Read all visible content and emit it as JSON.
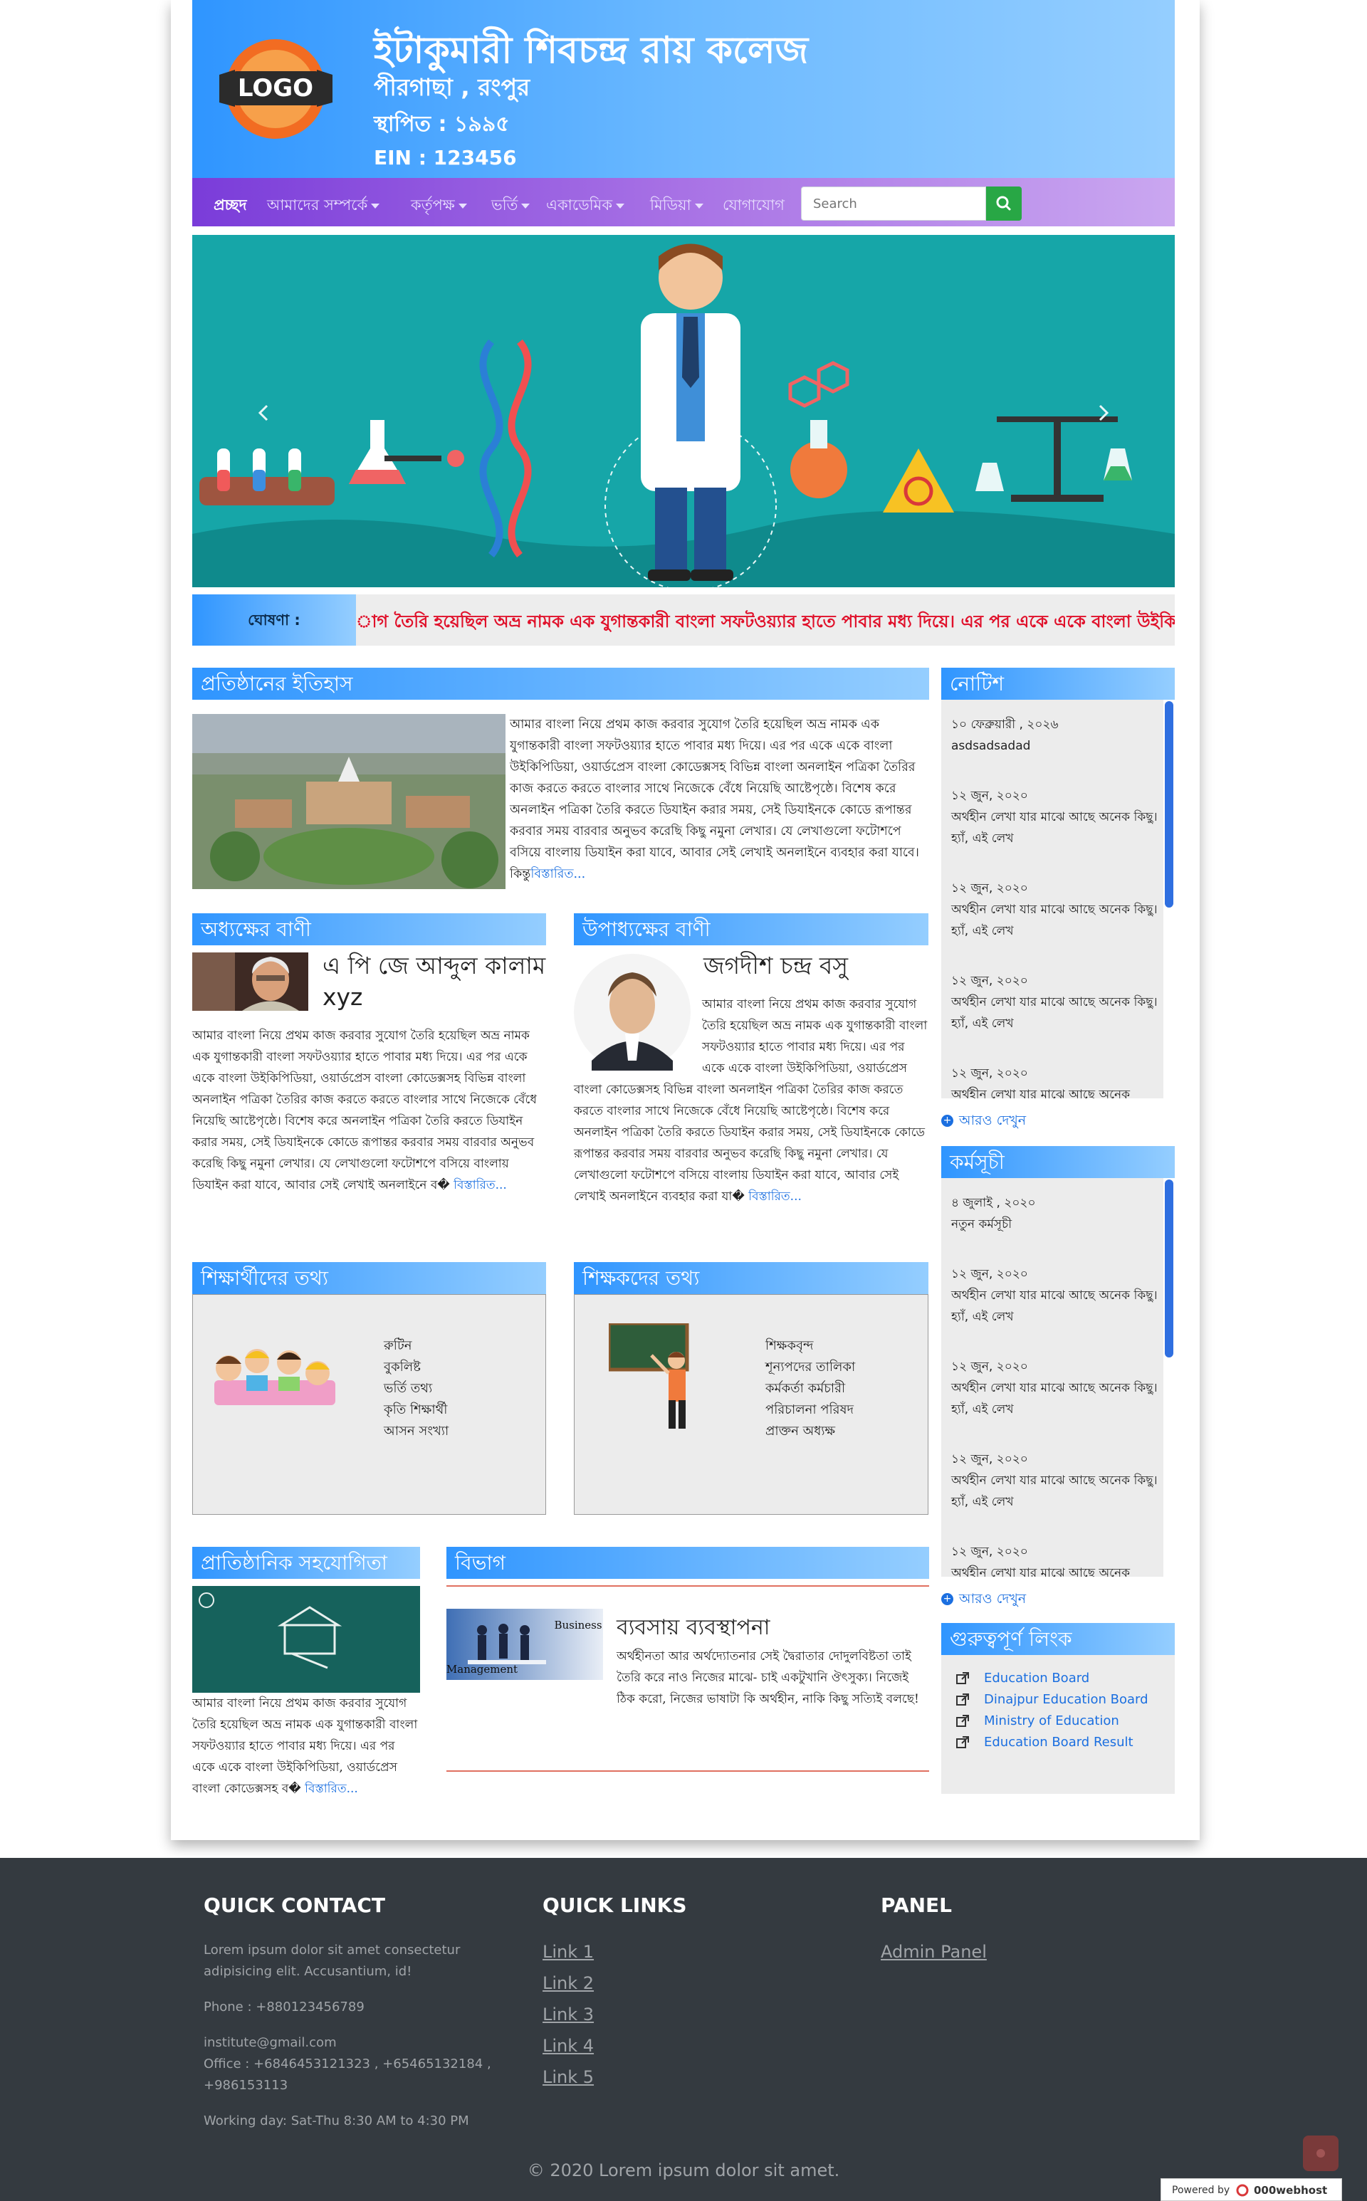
{
  "header": {
    "title": "ইটাকুমারী শিবচন্দ্র রায় কলেজ",
    "subtitle": "পীরগাছা , রংপুর",
    "established": "স্থাপিত : ১৯৯৫",
    "ein": "EIN : 123456",
    "logo_text": "LOGO"
  },
  "nav": {
    "items": [
      "প্রচ্ছদ",
      "আমাদের সম্পর্কে",
      "কর্তৃপক্ষ",
      "ভর্তি",
      "একাডেমিক",
      "মিডিয়া",
      "যোগাযোগ"
    ],
    "search_placeholder": "Search"
  },
  "ticker": {
    "label": "ঘোষণা :",
    "text": "াগ তৈরি হয়েছিল অভ্র নামক এক যুগান্তকারী বাংলা সফটওয়্যার হাতে পাবার মধ্য দিয়ে। এর পর একে একে বাংলা উইকিপিডিয়া, ওয়ার্ড"
  },
  "history": {
    "heading": "প্রতিষ্ঠানের ইতিহাস",
    "text": "আমার বাংলা নিয়ে প্রথম কাজ করবার সুযোগ তৈরি হয়েছিল অভ্র নামক এক যুগান্তকারী বাংলা সফটওয়্যার হাতে পাবার মধ্য দিয়ে। এর পর একে একে বাংলা উইকিপিডিয়া, ওয়ার্ডপ্রেস বাংলা কোডেক্সসহ বিভিন্ন বাংলা অনলাইন পত্রিকা তৈরির কাজ করতে করতে বাংলার সাথে নিজেকে বেঁধে নিয়েছি আষ্টেপৃষ্ঠে। বিশেষ করে অনলাইন পত্রিকা তৈরি করতে ডিযাইন করার সময়, সেই ডিযাইনকে কোডে রূপান্তর করবার সময় বারবার অনুভব করেছি কিছু নমুনা লেখার। যে লেখাগুলো ফটোশপে বসিয়ে বাংলায় ডিযাইন করা যাবে, আবার সেই লেখাই অনলাইনে ব্যবহার করা যাবে। কিন্তু",
    "more": "বিস্তারিত..."
  },
  "principal": {
    "heading": "অধ্যক্ষের বাণী",
    "name": "এ পি জে আব্দুল কালাম xyz",
    "text": "আমার বাংলা নিয়ে প্রথম কাজ করবার সুযোগ তৈরি হয়েছিল অভ্র নামক এক যুগান্তকারী বাংলা সফটওয়্যার হাতে পাবার মধ্য দিয়ে। এর পর একে একে বাংলা উইকিপিডিয়া, ওয়ার্ডপ্রেস বাংলা কোডেক্সসহ বিভিন্ন বাংলা অনলাইন পত্রিকা তৈরির কাজ করতে করতে বাংলার সাথে নিজেকে বেঁধে নিয়েছি আষ্টেপৃষ্ঠে। বিশেষ করে অনলাইন পত্রিকা তৈরি করতে ডিযাইন করার সময়, সেই ডিযাইনকে কোডে রূপান্তর করবার সময় বারবার অনুভব করেছি কিছু নমুনা লেখার। যে লেখাগুলো ফটোশপে বসিয়ে বাংলায় ডিযাইন করা যাবে, আবার সেই লেখাই অনলাইনে ব�",
    "more": "বিস্তারিত..."
  },
  "vice_principal": {
    "heading": "উপাধ্যক্ষের বাণী",
    "name": "জগদীশ চন্দ্র বসু",
    "text": "আমার বাংলা নিয়ে প্রথম কাজ করবার সুযোগ তৈরি হয়েছিল অভ্র নামক এক যুগান্তকারী বাংলা সফটওয়্যার হাতে পাবার মধ্য দিয়ে। এর পর একে একে বাংলা উইকিপিডিয়া, ওয়ার্ডপ্রেস বাংলা কোডেক্সসহ বিভিন্ন বাংলা অনলাইন পত্রিকা তৈরির কাজ করতে করতে বাংলার সাথে নিজেকে বেঁধে নিয়েছি আষ্টেপৃষ্ঠে। বিশেষ করে অনলাইন পত্রিকা তৈরি করতে ডিযাইন করার সময়, সেই ডিযাইনকে কোডে রূপান্তর করবার সময় বারবার অনুভব করেছি কিছু নমুনা লেখার। যে লেখাগুলো ফটোশপে বসিয়ে বাংলায় ডিযাইন করা যাবে, আবার সেই লেখাই অনলাইনে ব্যবহার করা যা�",
    "more": "বিস্তারিত..."
  },
  "students": {
    "heading": "শিক্ষার্থীদের তথ্য",
    "items": [
      "রুটিন",
      "বুকলিষ্ট",
      "ভর্তি তথ্য",
      "কৃতি শিক্ষার্থী",
      "আসন সংখ্যা"
    ]
  },
  "teachers": {
    "heading": "শিক্ষকদের তথ্য",
    "items": [
      "শিক্ষকবৃন্দ",
      "প্রাক্তন অধ্যক্ষ",
      "কর্মকর্তা কর্মচারী",
      "পরিচালনা পরিষদ",
      "শূন্যপদের তালিকা"
    ]
  },
  "cooperation": {
    "heading": "প্রাতিষ্ঠানিক সহযোগিতা",
    "text": "আমার বাংলা নিয়ে প্রথম কাজ করবার সুযোগ তৈরি হয়েছিল অভ্র নামক এক যুগান্তকারী বাংলা সফটওয়্যার হাতে পাবার মধ্য দিয়ে। এর পর একে একে বাংলা উইকিপিডিয়া, ওয়ার্ডপ্রেস বাংলা কোডেক্সসহ ব�",
    "more": "বিস্তারিত..."
  },
  "department": {
    "heading": "বিভাগ",
    "name": "ব্যবসায় ব্যবস্থাপনা",
    "text": "অর্থহীনতা আর অর্থদ্যোতনার সেই দ্বৈরাতার দোদুলবিষ্টতা তাই তৈরি করে নাও নিজের মাঝে- চাই একটুখানি ঔৎসুক্য। নিজেই ঠিক করো, নিজের ভাষাটা কি অর্থহীন, নাকি কিছু সত্যিই বলছে!",
    "image_text_1": "Business",
    "image_text_2": "Management"
  },
  "notice": {
    "heading": "নোটিশ",
    "items": [
      {
        "date": "১০ ফেব্রুয়ারী , ২০২৬",
        "text": "asdsadsadad"
      },
      {
        "date": "১২ জুন, ২০২০",
        "text": "অর্থহীন লেখা যার মাঝে আছে অনেক কিছু। হ্যাঁ, এই লেখ"
      },
      {
        "date": "১২ জুন, ২০২০",
        "text": "অর্থহীন লেখা যার মাঝে আছে অনেক কিছু। হ্যাঁ, এই লেখ"
      },
      {
        "date": "১২ জুন, ২০২০",
        "text": "অর্থহীন লেখা যার মাঝে আছে অনেক কিছু। হ্যাঁ, এই লেখ"
      },
      {
        "date": "১২ জুন, ২০২০",
        "text": "অর্থহীন লেখা যার মাঝে আছে অনেক"
      }
    ],
    "more": "আরও দেখুন"
  },
  "program": {
    "heading": "কর্মসূচী",
    "items": [
      {
        "date": "৪ জুলাই , ২০২০",
        "text": "নতুন কর্মসূচী"
      },
      {
        "date": "১২ জুন, ২০২০",
        "text": "অর্থহীন লেখা যার মাঝে আছে অনেক কিছু। হ্যাঁ, এই লেখ"
      },
      {
        "date": "১২ জুন, ২০২০",
        "text": "অর্থহীন লেখা যার মাঝে আছে অনেক কিছু। হ্যাঁ, এই লেখ"
      },
      {
        "date": "১২ জুন, ২০২০",
        "text": "অর্থহীন লেখা যার মাঝে আছে অনেক কিছু। হ্যাঁ, এই লেখ"
      },
      {
        "date": "১২ জুন, ২০২০",
        "text": "অর্থহীন লেখা যার মাঝে আছে অনেক"
      }
    ],
    "more": "আরও দেখুন"
  },
  "important_links": {
    "heading": "গুরুত্বপূর্ণ লিংক",
    "items": [
      "Education Board",
      "Dinajpur Education Board",
      "Ministry of Education",
      "Education Board Result"
    ]
  },
  "footer": {
    "contact_heading": "QUICK CONTACT",
    "contact_text": "Lorem ipsum dolor sit amet consectetur adipisicing elit. Accusantium, id!",
    "phone": "Phone : +880123456789",
    "email": "institute@gmail.com",
    "office": "Office : +6846453121323 , +65465132184 , +986153113",
    "hours": "Working day: Sat-Thu 8:30 AM to 4:30 PM",
    "links_heading": "QUICK LINKS",
    "links": [
      "Link 1",
      "Link 2",
      "Link 3",
      "Link 4",
      "Link 5"
    ],
    "panel_heading": "PANEL",
    "panel_link": "Admin Panel",
    "copyright": "© 2020 Lorem ipsum dolor sit amet.",
    "powered_by": "Powered by",
    "host": "000webhost"
  },
  "colors": {
    "header_start": "#2f95ff",
    "header_end": "#95ceff",
    "nav_start": "#7a3cd9",
    "nav_end": "#caa7f0",
    "search_button": "#28a745",
    "ticker_text": "#e0102a",
    "footer_bg": "#343a40",
    "link": "#1b6fe0"
  }
}
